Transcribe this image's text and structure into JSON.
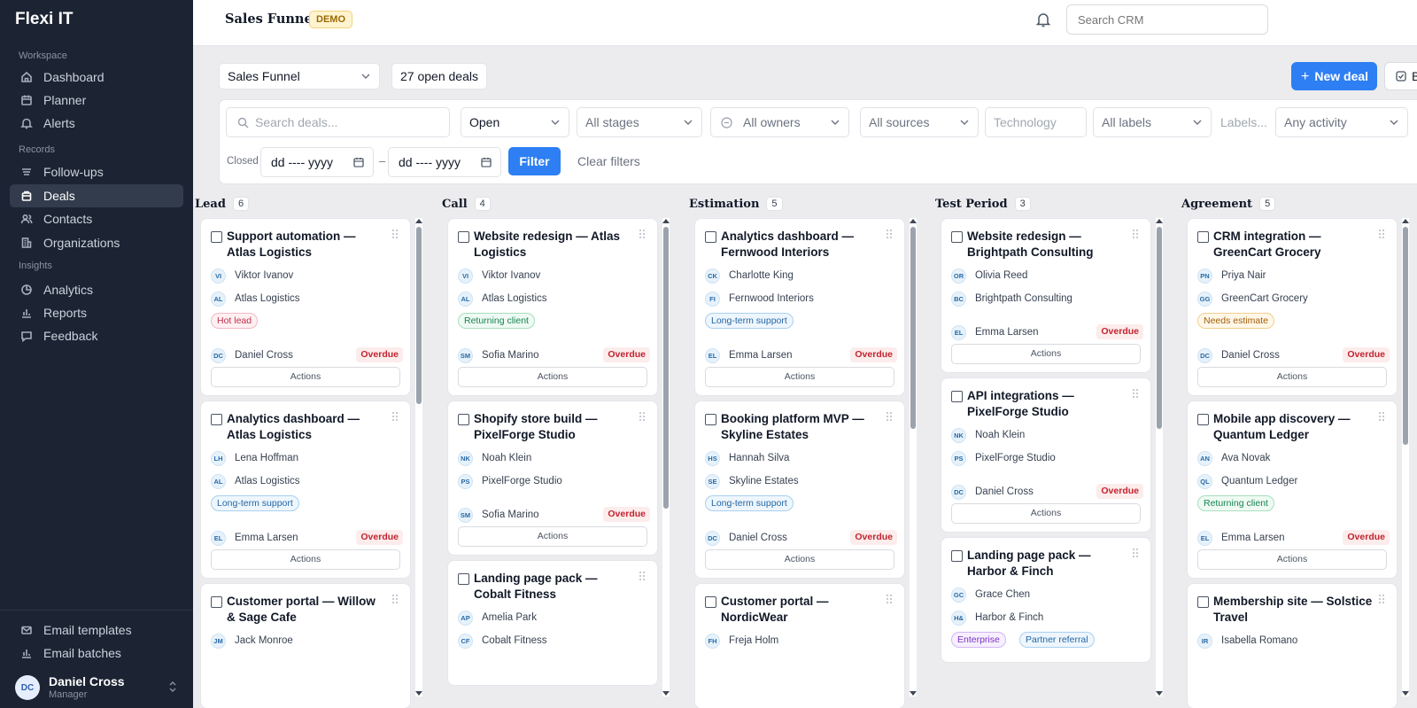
{
  "app": {
    "brand": "Flexi IT"
  },
  "sidebar": {
    "sections": [
      "Workspace",
      "Records",
      "Insights"
    ],
    "workspace": [
      {
        "label": "Dashboard",
        "icon": "home-icon"
      },
      {
        "label": "Planner",
        "icon": "calendar-icon"
      },
      {
        "label": "Alerts",
        "icon": "bell-icon"
      }
    ],
    "records": [
      {
        "label": "Follow-ups",
        "icon": "list-icon"
      },
      {
        "label": "Deals",
        "icon": "briefcase-icon",
        "active": true
      },
      {
        "label": "Contacts",
        "icon": "users-icon"
      },
      {
        "label": "Organizations",
        "icon": "building-icon"
      }
    ],
    "insights": [
      {
        "label": "Analytics",
        "icon": "pie-icon"
      },
      {
        "label": "Reports",
        "icon": "bar-chart-icon"
      },
      {
        "label": "Feedback",
        "icon": "message-icon"
      }
    ],
    "bottom": [
      {
        "label": "Email templates",
        "icon": "mail-icon"
      },
      {
        "label": "Email batches",
        "icon": "bar-chart-icon"
      }
    ],
    "user": {
      "initials": "DC",
      "name": "Daniel Cross",
      "role": "Manager"
    }
  },
  "header": {
    "title": "Sales Funnel",
    "badge": "DEMO",
    "search_placeholder": "Search CRM"
  },
  "toolbar": {
    "pipeline": "Sales Funnel",
    "open_deals": "27 open deals",
    "new_deal": "New deal",
    "bulk_label": "B"
  },
  "filters": {
    "search_placeholder": "Search deals...",
    "status": "Open",
    "stages": "All stages",
    "owners": "All owners",
    "sources": "All sources",
    "technology_placeholder": "Technology",
    "labels": "All labels",
    "labels_placeholder": "Labels...",
    "activity": "Any activity",
    "closed_label": "Closed",
    "date_placeholder": "dd ---- yyyy",
    "date_separator": "–",
    "filter_button": "Filter",
    "clear_button": "Clear filters"
  },
  "board": {
    "actions_label": "Actions",
    "overdue_label": "Overdue",
    "columns": [
      {
        "name": "Lead",
        "count": "6",
        "cards": [
          {
            "title": "Support automation — Atlas Logistics",
            "contact": {
              "i": "VI",
              "n": "Viktor Ivanov"
            },
            "org": {
              "i": "AL",
              "n": "Atlas Logistics"
            },
            "tags": [
              {
                "t": "Hot lead",
                "c": "red"
              }
            ],
            "owner": {
              "i": "DC",
              "n": "Daniel Cross"
            },
            "overdue": true
          },
          {
            "title": "Analytics dashboard — Atlas Logistics",
            "contact": {
              "i": "LH",
              "n": "Lena Hoffman"
            },
            "org": {
              "i": "AL",
              "n": "Atlas Logistics"
            },
            "tags": [
              {
                "t": "Long-term support",
                "c": "blue"
              }
            ],
            "owner": {
              "i": "EL",
              "n": "Emma Larsen"
            },
            "overdue": true
          },
          {
            "title": "Customer portal — Willow & Sage Cafe",
            "contact": {
              "i": "JM",
              "n": "Jack Monroe"
            },
            "org": null,
            "tags": [],
            "owner": null,
            "overdue": false
          }
        ]
      },
      {
        "name": "Call",
        "count": "4",
        "cards": [
          {
            "title": "Website redesign — Atlas Logistics",
            "contact": {
              "i": "VI",
              "n": "Viktor Ivanov"
            },
            "org": {
              "i": "AL",
              "n": "Atlas Logistics"
            },
            "tags": [
              {
                "t": "Returning client",
                "c": "green"
              }
            ],
            "owner": {
              "i": "SM",
              "n": "Sofia Marino"
            },
            "overdue": true
          },
          {
            "title": "Shopify store build — PixelForge Studio",
            "contact": {
              "i": "NK",
              "n": "Noah Klein"
            },
            "org": {
              "i": "PS",
              "n": "PixelForge Studio"
            },
            "tags": [],
            "owner": {
              "i": "SM",
              "n": "Sofia Marino"
            },
            "overdue": true
          },
          {
            "title": "Landing page pack — Cobalt Fitness",
            "contact": {
              "i": "AP",
              "n": "Amelia Park"
            },
            "org": {
              "i": "CF",
              "n": "Cobalt Fitness"
            },
            "tags": [],
            "owner": null,
            "overdue": false
          }
        ]
      },
      {
        "name": "Estimation",
        "count": "5",
        "cards": [
          {
            "title": "Analytics dashboard — Fernwood Interiors",
            "contact": {
              "i": "CK",
              "n": "Charlotte King"
            },
            "org": {
              "i": "FI",
              "n": "Fernwood Interiors"
            },
            "tags": [
              {
                "t": "Long-term support",
                "c": "blue"
              }
            ],
            "owner": {
              "i": "EL",
              "n": "Emma Larsen"
            },
            "overdue": true
          },
          {
            "title": "Booking platform MVP — Skyline Estates",
            "contact": {
              "i": "HS",
              "n": "Hannah Silva"
            },
            "org": {
              "i": "SE",
              "n": "Skyline Estates"
            },
            "tags": [
              {
                "t": "Long-term support",
                "c": "blue"
              }
            ],
            "owner": {
              "i": "DC",
              "n": "Daniel Cross"
            },
            "overdue": true
          },
          {
            "title": "Customer portal — NordicWear",
            "contact": {
              "i": "FH",
              "n": "Freja Holm"
            },
            "org": null,
            "tags": [],
            "owner": null,
            "overdue": false
          }
        ]
      },
      {
        "name": "Test Period",
        "count": "3",
        "cards": [
          {
            "title": "Website redesign — Brightpath Consulting",
            "contact": {
              "i": "OR",
              "n": "Olivia Reed"
            },
            "org": {
              "i": "BC",
              "n": "Brightpath Consulting"
            },
            "tags": [],
            "owner": {
              "i": "EL",
              "n": "Emma Larsen"
            },
            "overdue": true
          },
          {
            "title": "API integrations — PixelForge Studio",
            "contact": {
              "i": "NK",
              "n": "Noah Klein"
            },
            "org": {
              "i": "PS",
              "n": "PixelForge Studio"
            },
            "tags": [],
            "owner": {
              "i": "DC",
              "n": "Daniel Cross"
            },
            "overdue": true
          },
          {
            "title": "Landing page pack — Harbor & Finch",
            "contact": {
              "i": "GC",
              "n": "Grace Chen"
            },
            "org": {
              "i": "H&",
              "n": "Harbor & Finch"
            },
            "tags": [
              {
                "t": "Enterprise",
                "c": "purple"
              },
              {
                "t": "Partner referral",
                "c": "blue"
              }
            ],
            "owner": null,
            "overdue": false
          }
        ]
      },
      {
        "name": "Agreement",
        "count": "5",
        "cards": [
          {
            "title": "CRM integration — GreenCart Grocery",
            "contact": {
              "i": "PN",
              "n": "Priya Nair"
            },
            "org": {
              "i": "GG",
              "n": "GreenCart Grocery"
            },
            "tags": [
              {
                "t": "Needs estimate",
                "c": "amber"
              }
            ],
            "owner": {
              "i": "DC",
              "n": "Daniel Cross"
            },
            "overdue": true
          },
          {
            "title": "Mobile app discovery — Quantum Ledger",
            "contact": {
              "i": "AN",
              "n": "Ava Novak"
            },
            "org": {
              "i": "QL",
              "n": "Quantum Ledger"
            },
            "tags": [
              {
                "t": "Returning client",
                "c": "green"
              }
            ],
            "owner": {
              "i": "EL",
              "n": "Emma Larsen"
            },
            "overdue": true
          },
          {
            "title": "Membership site — Solstice Travel",
            "contact": {
              "i": "IR",
              "n": "Isabella Romano"
            },
            "org": null,
            "tags": [],
            "owner": null,
            "overdue": false
          }
        ]
      }
    ]
  }
}
